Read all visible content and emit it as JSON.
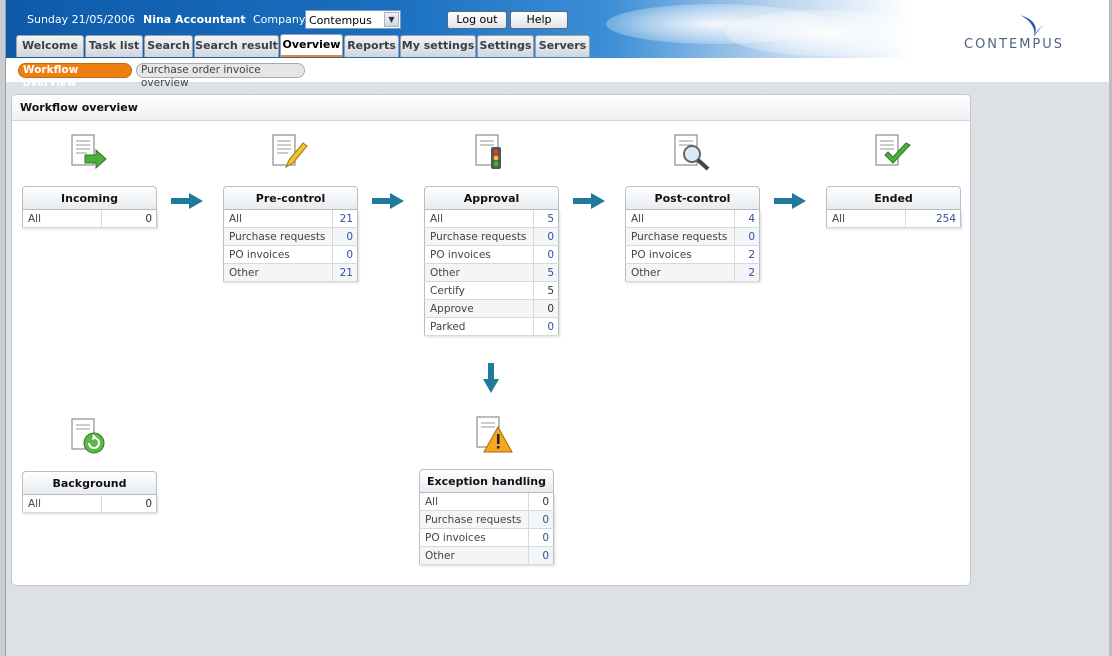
{
  "header": {
    "date": "Sunday 21/05/2006",
    "user": "Nina Accountant",
    "company_label": "Company:",
    "company_value": "Contempus",
    "logout_label": "Log out",
    "help_label": "Help",
    "logo_text": "CONTEMPUS"
  },
  "tabs": [
    {
      "label": "Welcome"
    },
    {
      "label": "Task list"
    },
    {
      "label": "Search"
    },
    {
      "label": "Search result"
    },
    {
      "label": "Overview"
    },
    {
      "label": "Reports"
    },
    {
      "label": "My settings"
    },
    {
      "label": "Settings"
    },
    {
      "label": "Servers"
    }
  ],
  "subtabs": [
    {
      "label": "Workflow overview"
    },
    {
      "label": "Purchase order invoice overview"
    }
  ],
  "panel": {
    "title": "Workflow overview"
  },
  "stages": {
    "incoming": {
      "title": "Incoming",
      "rows": [
        {
          "label": "All",
          "value": "0"
        }
      ]
    },
    "precontrol": {
      "title": "Pre-control",
      "rows": [
        {
          "label": "All",
          "value": "21"
        },
        {
          "label": "Purchase requests",
          "value": "0"
        },
        {
          "label": "PO invoices",
          "value": "0"
        },
        {
          "label": "Other",
          "value": "21"
        }
      ]
    },
    "approval": {
      "title": "Approval",
      "rows": [
        {
          "label": "All",
          "value": "5"
        },
        {
          "label": "Purchase requests",
          "value": "0"
        },
        {
          "label": "PO invoices",
          "value": "0"
        },
        {
          "label": "Other",
          "value": "5"
        },
        {
          "label": "Certify",
          "value": "5"
        },
        {
          "label": "Approve",
          "value": "0"
        },
        {
          "label": "Parked",
          "value": "0"
        }
      ]
    },
    "postcontrol": {
      "title": "Post-control",
      "rows": [
        {
          "label": "All",
          "value": "4"
        },
        {
          "label": "Purchase requests",
          "value": "0"
        },
        {
          "label": "PO invoices",
          "value": "2"
        },
        {
          "label": "Other",
          "value": "2"
        }
      ]
    },
    "ended": {
      "title": "Ended",
      "rows": [
        {
          "label": "All",
          "value": "254"
        }
      ]
    },
    "background": {
      "title": "Background",
      "rows": [
        {
          "label": "All",
          "value": "0"
        }
      ]
    },
    "exception": {
      "title": "Exception handling",
      "rows": [
        {
          "label": "All",
          "value": "0"
        },
        {
          "label": "Purchase requests",
          "value": "0"
        },
        {
          "label": "PO invoices",
          "value": "0"
        },
        {
          "label": "Other",
          "value": "0"
        }
      ]
    }
  },
  "colors": {
    "accent": "#f07f12",
    "header_blue": "#0e5aa8",
    "arrow": "#1f7a9c",
    "link": "#2f4fa3"
  }
}
